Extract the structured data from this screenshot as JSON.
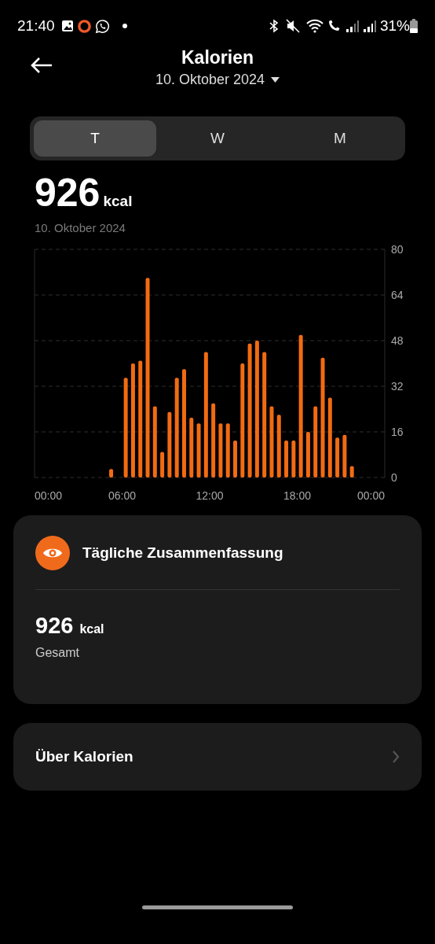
{
  "status_bar": {
    "time": "21:40",
    "battery": "31%"
  },
  "header": {
    "title": "Kalorien",
    "date": "10. Oktober 2024"
  },
  "tabs": [
    {
      "label": "T",
      "selected": true
    },
    {
      "label": "W",
      "selected": false
    },
    {
      "label": "M",
      "selected": false
    }
  ],
  "summary": {
    "value": "926",
    "unit": "kcal",
    "date": "10. Oktober 2024"
  },
  "chart_data": {
    "type": "bar",
    "xlim": [
      0,
      24
    ],
    "ylim": [
      0,
      80
    ],
    "yticks": [
      0,
      16,
      32,
      48,
      64,
      80
    ],
    "xticks": [
      {
        "value": 0,
        "label": "00:00"
      },
      {
        "value": 6,
        "label": "06:00"
      },
      {
        "value": 12,
        "label": "12:00"
      },
      {
        "value": 18,
        "label": "18:00"
      },
      {
        "value": 24,
        "label": "00:00"
      }
    ],
    "grid": true,
    "x": [
      5.25,
      5.75,
      6.25,
      6.75,
      7.25,
      7.75,
      8.25,
      8.75,
      9.25,
      9.75,
      10.25,
      10.75,
      11.25,
      11.75,
      12.25,
      12.75,
      13.25,
      13.75,
      14.25,
      14.75,
      15.25,
      15.75,
      16.25,
      16.75,
      17.25,
      17.75,
      18.25,
      18.75,
      19.25,
      19.75,
      20.25,
      20.75,
      21.25,
      21.75
    ],
    "series": [
      {
        "color": "#f26b12",
        "values": [
          3,
          0,
          35,
          40,
          41,
          70,
          25,
          9,
          23,
          35,
          38,
          21,
          19,
          44,
          26,
          19,
          19,
          13,
          40,
          47,
          48,
          44,
          25,
          22,
          13,
          13,
          50,
          16,
          25,
          42,
          28,
          14,
          15,
          4
        ]
      }
    ]
  },
  "daily_card": {
    "title": "Tägliche Zusammenfassung",
    "value": "926",
    "unit": "kcal",
    "label": "Gesamt"
  },
  "about_row": {
    "label": "Über Kalorien"
  }
}
